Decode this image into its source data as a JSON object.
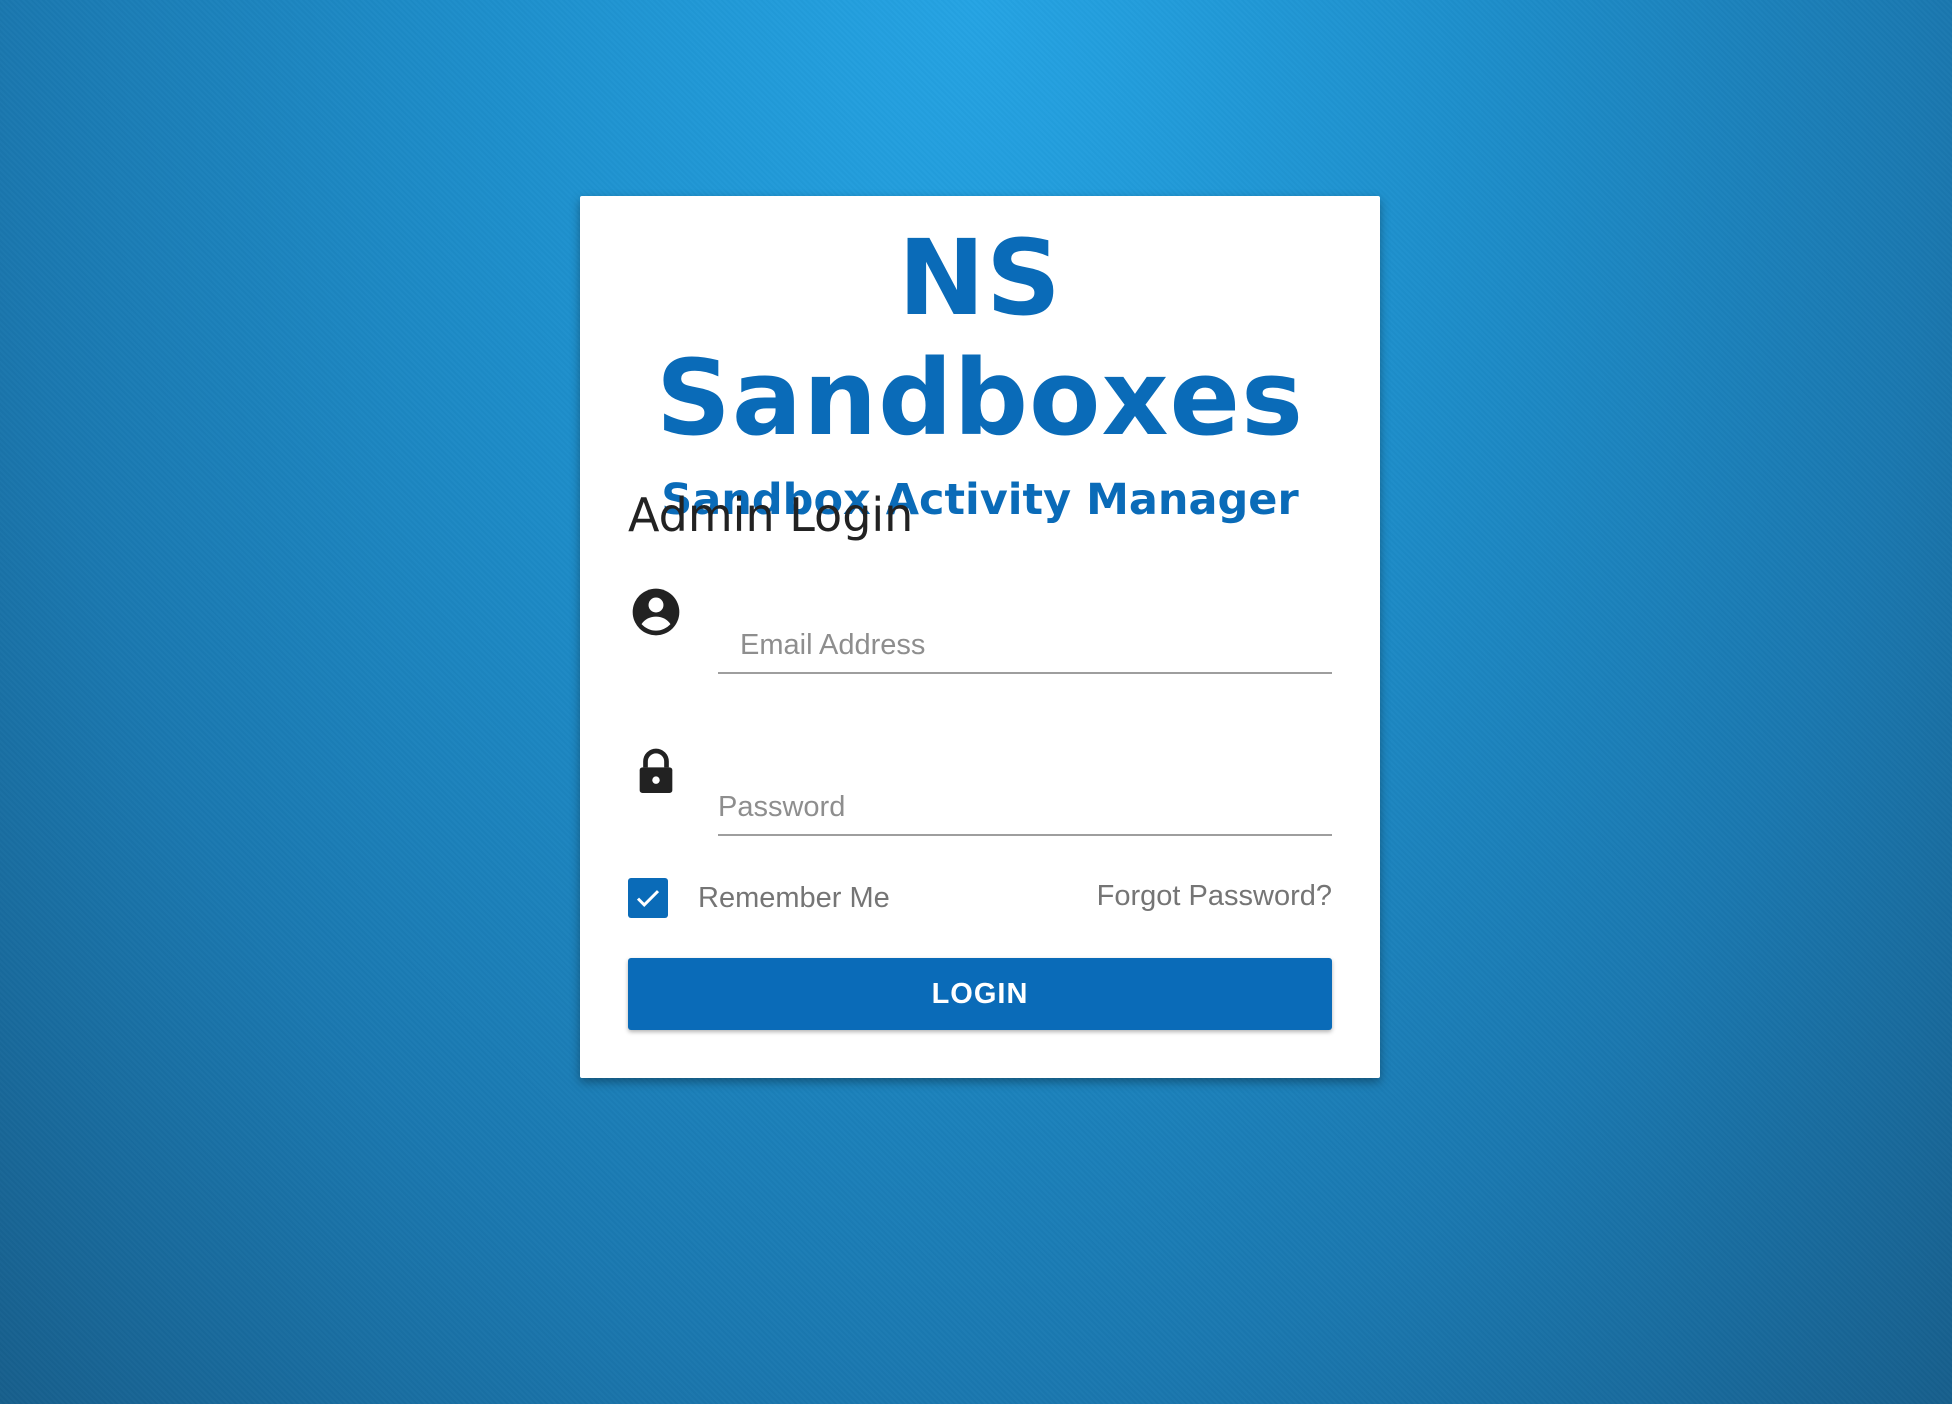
{
  "brand": {
    "title": "NS Sandboxes",
    "subtitle": "Sandbox Activity Manager",
    "color": "#0a6bb8"
  },
  "login": {
    "heading": "Admin Login",
    "email": {
      "placeholder": "Email Address",
      "value": "",
      "icon": "account-circle-icon"
    },
    "password": {
      "placeholder": "Password",
      "value": "",
      "icon": "lock-icon"
    },
    "remember_me": {
      "label": "Remember Me",
      "checked": true
    },
    "forgot_password": "Forgot Password?",
    "submit_label": "LOGIN"
  },
  "colors": {
    "background": "#1d8fcc",
    "accent": "#0a6bb8",
    "card": "#ffffff"
  }
}
